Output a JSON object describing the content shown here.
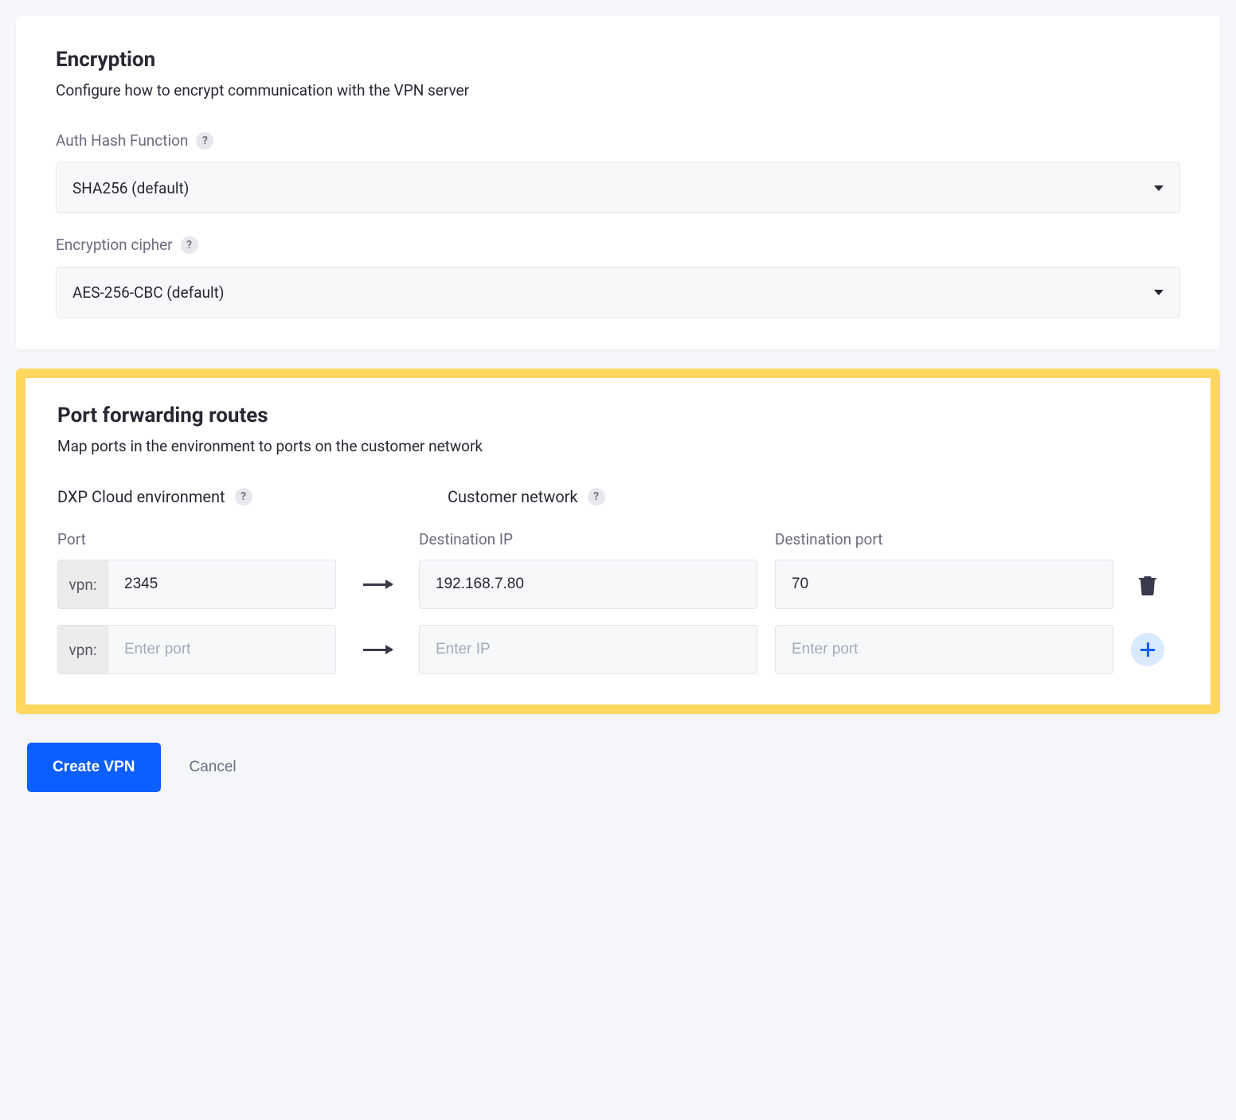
{
  "encryption": {
    "title": "Encryption",
    "description": "Configure how to encrypt communication with the VPN server",
    "auth_hash": {
      "label": "Auth Hash Function",
      "value": "SHA256 (default)"
    },
    "cipher": {
      "label": "Encryption cipher",
      "value": "AES-256-CBC (default)"
    }
  },
  "port_forwarding": {
    "title": "Port forwarding routes",
    "description": "Map ports in the environment to ports on the customer network",
    "env_col_title": "DXP Cloud environment",
    "net_col_title": "Customer network",
    "labels": {
      "port": "Port",
      "dest_ip": "Destination IP",
      "dest_port": "Destination port",
      "prefix": "vpn:"
    },
    "rows": [
      {
        "port": "2345",
        "dest_ip": "192.168.7.80",
        "dest_port": "70"
      }
    ],
    "placeholders": {
      "port": "Enter port",
      "ip": "Enter IP",
      "dest_port": "Enter port"
    }
  },
  "actions": {
    "create": "Create VPN",
    "cancel": "Cancel"
  }
}
